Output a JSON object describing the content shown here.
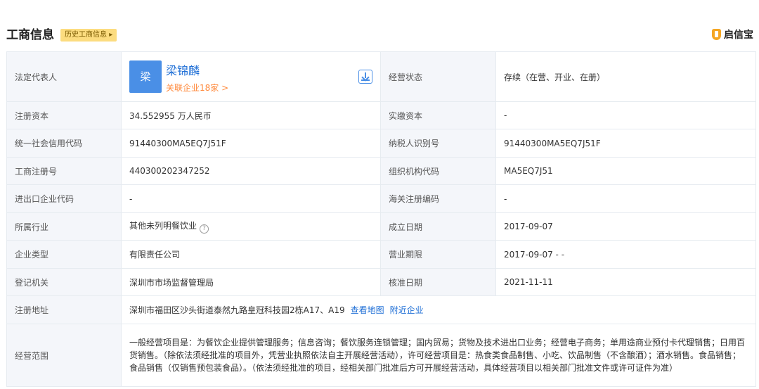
{
  "header": {
    "title": "工商信息",
    "history_tag": "历史工商信息",
    "brand": "启信宝"
  },
  "rep": {
    "label": "法定代表人",
    "avatar_char": "梁",
    "name": "梁锦麟",
    "related": "关联企业18家 >"
  },
  "rows": {
    "status_label": "经营状态",
    "status_value": "存续（在营、开业、在册）",
    "capital_label": "注册资本",
    "capital_value": "34.552955 万人民币",
    "paid_label": "实缴资本",
    "paid_value": "-",
    "credit_label": "统一社会信用代码",
    "credit_value": "91440300MA5EQ7J51F",
    "taxpayer_label": "纳税人识别号",
    "taxpayer_value": "91440300MA5EQ7J51F",
    "regno_label": "工商注册号",
    "regno_value": "440300202347252",
    "org_label": "组织机构代码",
    "org_value": "MA5EQ7J51",
    "import_label": "进出口企业代码",
    "import_value": "-",
    "customs_label": "海关注册编码",
    "customs_value": "-",
    "industry_label": "所属行业",
    "industry_value": "其他未列明餐饮业",
    "founded_label": "成立日期",
    "founded_value": "2017-09-07",
    "type_label": "企业类型",
    "type_value": "有限责任公司",
    "term_label": "营业期限",
    "term_value": "2017-09-07 - -",
    "authority_label": "登记机关",
    "authority_value": "深圳市市场监督管理局",
    "approved_label": "核准日期",
    "approved_value": "2021-11-11",
    "address_label": "注册地址",
    "address_value": "深圳市福田区沙头街道泰然九路皇冠科技园2栋A17、A19",
    "address_map_link": "查看地图",
    "address_nearby_link": "附近企业",
    "scope_label": "经营范围",
    "scope_value": "一般经营项目是：为餐饮企业提供管理服务；信息咨询；餐饮服务连锁管理；国内贸易；货物及技术进出口业务；经营电子商务；单用途商业预付卡代理销售；日用百货销售。（除依法须经批准的项目外，凭营业执照依法自主开展经营活动），许可经营项目是：热食类食品制售、小吃、饮品制售（不含酿酒）；酒水销售。食品销售；食品销售（仅销售预包装食品）。（依法须经批准的项目，经相关部门批准后方可开展经营活动，具体经营项目以相关部门批准文件或许可证件为准）"
  },
  "colors": {
    "accent": "#1f6fd6",
    "tag_bg": "#fcdc7f",
    "related": "#ff8a3d",
    "label_bg": "#f4f6fa",
    "brand": "#f5a623"
  },
  "icons": [
    "download-icon",
    "help-icon",
    "brand-logo-icon",
    "chevron-right-icon"
  ]
}
